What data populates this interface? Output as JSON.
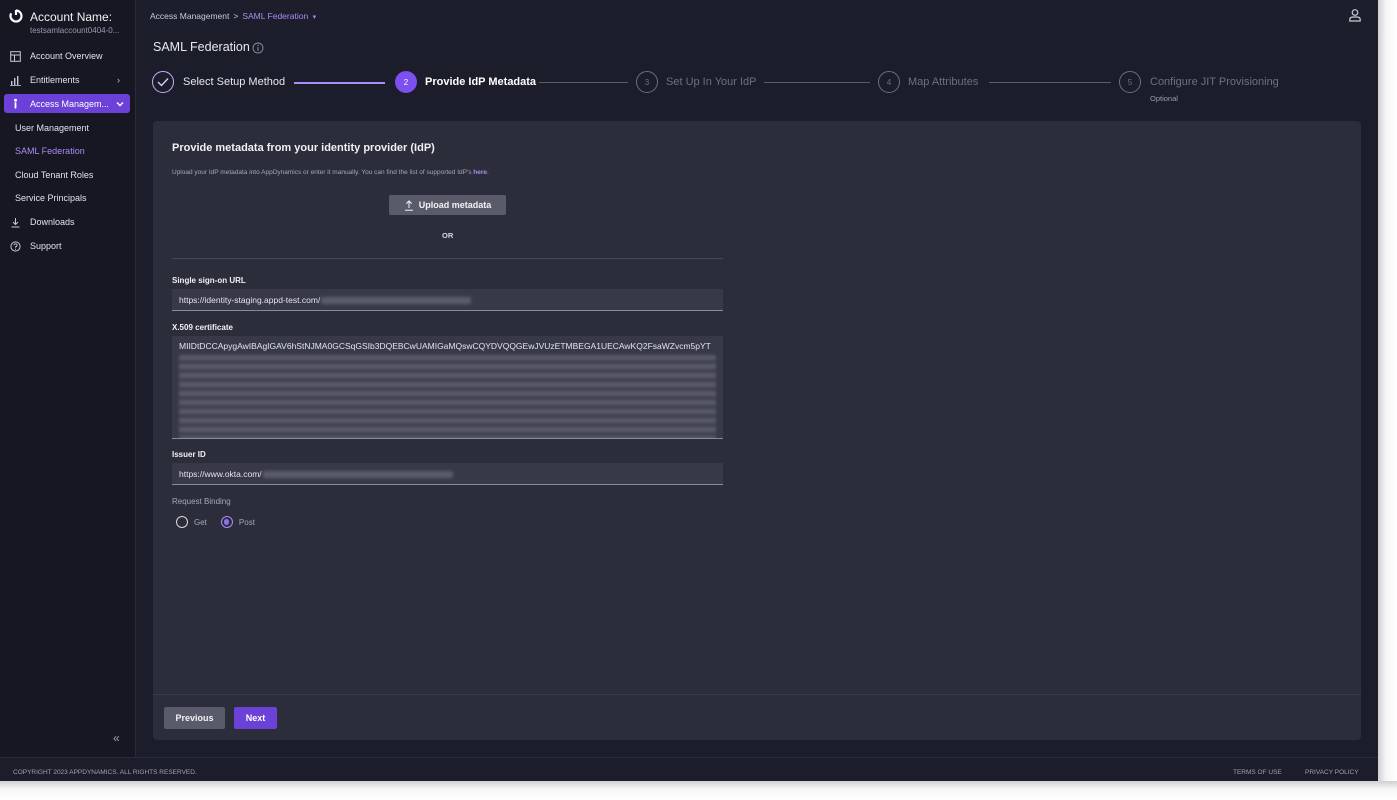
{
  "account": {
    "title": "Account Name:",
    "subtitle": "testsamlaccount0404-0..."
  },
  "sidebar": {
    "items": [
      {
        "label": "Account Overview",
        "icon": "overview-icon"
      },
      {
        "label": "Entitlements",
        "icon": "bar-chart-icon"
      },
      {
        "label": "Access Managem...",
        "icon": "person-icon"
      },
      {
        "label": "Downloads",
        "icon": "download-icon"
      },
      {
        "label": "Support",
        "icon": "help-icon"
      }
    ],
    "sub_items": [
      "User Management",
      "SAML Federation",
      "Cloud Tenant Roles",
      "Service Principals"
    ],
    "collapse_glyph": "«"
  },
  "breadcrumb": {
    "parent": "Access Management",
    "separator": ">",
    "current": "SAML Federation"
  },
  "page": {
    "title": "SAML Federation"
  },
  "stepper": {
    "steps": [
      {
        "number": "1",
        "label": "Select Setup Method",
        "state": "done"
      },
      {
        "number": "2",
        "label": "Provide IdP Metadata",
        "state": "active"
      },
      {
        "number": "3",
        "label": "Set Up In Your IdP",
        "state": "todo"
      },
      {
        "number": "4",
        "label": "Map Attributes",
        "state": "todo"
      },
      {
        "number": "5",
        "label": "Configure JIT Provisioning",
        "state": "todo",
        "sublabel": "Optional"
      }
    ]
  },
  "card": {
    "title": "Provide metadata from your identity provider (IdP)",
    "description": "Upload your IdP metadata into AppDynamics or enter it manually. You can find the list of supported IdP's ",
    "description_link": "here",
    "description_end": ".",
    "upload_label": "Upload metadata",
    "or_label": "OR"
  },
  "form": {
    "sso_label": "Single sign-on URL",
    "sso_value": "https://identity-staging.appd-test.com/",
    "cert_label": "X.509 certificate",
    "cert_value": "MIIDtDCCApygAwIBAgIGAV6hStNJMA0GCSqGSIb3DQEBCwUAMIGaMQswCQYDVQQGEwJVUzETMBEGA1UECAwKQ2FsaWZvcm5pYT",
    "issuer_label": "Issuer ID",
    "issuer_value": "https://www.okta.com/",
    "binding_label": "Request Binding",
    "binding_options": [
      "Get",
      "Post"
    ],
    "binding_selected": "Post"
  },
  "buttons": {
    "previous": "Previous",
    "next": "Next"
  },
  "footer": {
    "copyright": "COPYRIGHT 2023 APPDYNAMICS. ALL RIGHTS RESERVED.",
    "terms": "TERMS OF USE",
    "privacy": "PRIVACY POLICY"
  },
  "colors": {
    "accent": "#6b41d8",
    "accent_light": "#a98cf5",
    "background": "#1c1d2a",
    "card": "#2c2d3b"
  }
}
